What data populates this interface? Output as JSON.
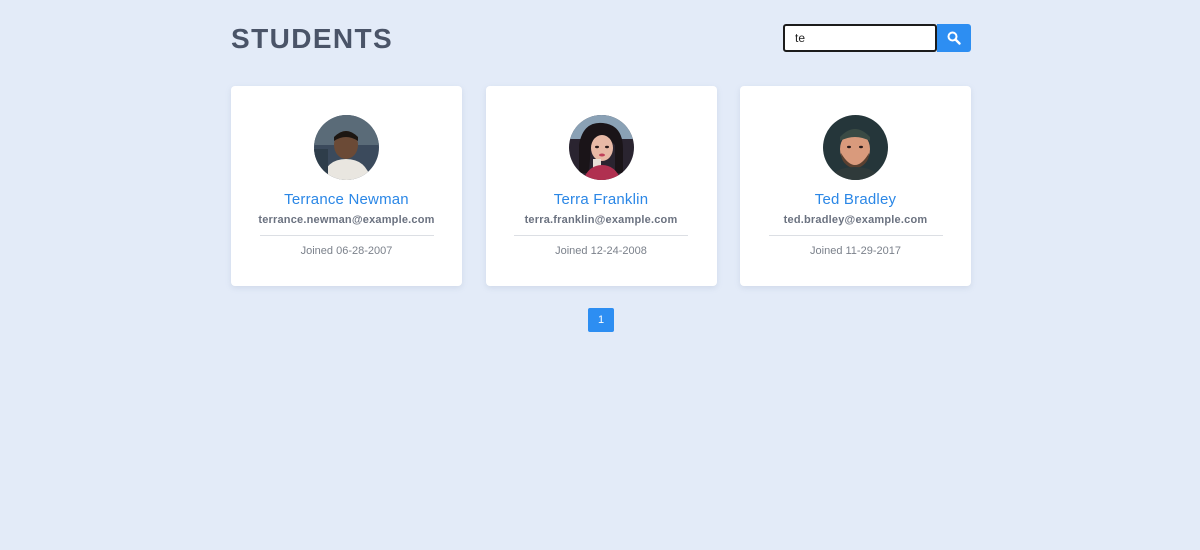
{
  "header": {
    "title": "STUDENTS"
  },
  "search": {
    "value": "te",
    "placeholder": ""
  },
  "students": [
    {
      "name": "Terrance Newman",
      "email": "terrance.newman@example.com",
      "joined": "Joined 06-28-2007"
    },
    {
      "name": "Terra Franklin",
      "email": "terra.franklin@example.com",
      "joined": "Joined 12-24-2008"
    },
    {
      "name": "Ted Bradley",
      "email": "ted.bradley@example.com",
      "joined": "Joined 11-29-2017"
    }
  ],
  "pagination": {
    "current_page": "1"
  },
  "colors": {
    "background": "#e3ebf8",
    "accent": "#2d8ef2",
    "name": "#2b87e6",
    "title": "#4a5468"
  },
  "icons": {
    "search": "search-icon"
  }
}
